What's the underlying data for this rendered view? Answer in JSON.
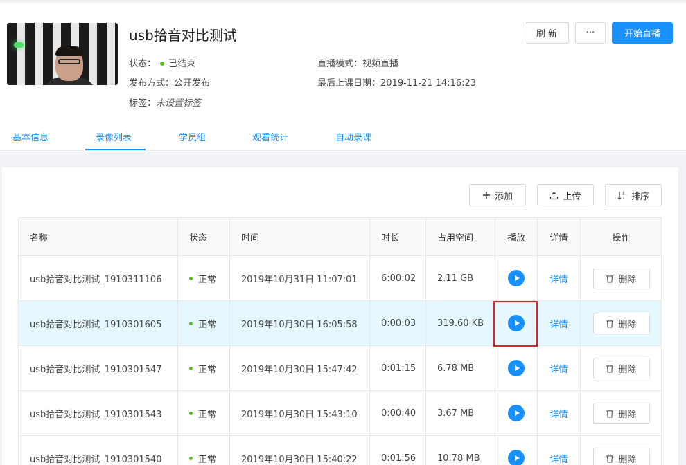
{
  "header": {
    "title": "usb拾音对比测试",
    "status_label": "状态：",
    "status_value": "已结束",
    "publish_label": "发布方式：",
    "publish_value": "公开发布",
    "tag_label": "标签：",
    "tag_value": "未设置标签",
    "mode_label": "直播模式：",
    "mode_value": "视频直播",
    "last_date_label": "最后上课日期：",
    "last_date_value": "2019-11-21 14:16:23",
    "refresh_label": "刷 新",
    "more_label": "···",
    "start_label": "开始直播"
  },
  "tabs": [
    {
      "label": "基本信息"
    },
    {
      "label": "录像列表"
    },
    {
      "label": "学员组"
    },
    {
      "label": "观看统计"
    },
    {
      "label": "自动录课"
    }
  ],
  "toolbar": {
    "add_label": "添加",
    "upload_label": "上传",
    "sort_label": "排序"
  },
  "table": {
    "columns": [
      "名称",
      "状态",
      "时间",
      "时长",
      "占用空间",
      "播放",
      "详情",
      "操作"
    ],
    "detail_label": "详情",
    "delete_label": "删除",
    "rows": [
      {
        "name": "usb拾音对比测试_1910311106",
        "status": "正常",
        "time": "2019年10月31日 11:07:01",
        "duration": "6:00:02",
        "size": "2.11 GB"
      },
      {
        "name": "usb拾音对比测试_1910301605",
        "status": "正常",
        "time": "2019年10月30日 16:05:58",
        "duration": "0:00:03",
        "size": "319.60 KB"
      },
      {
        "name": "usb拾音对比测试_1910301547",
        "status": "正常",
        "time": "2019年10月30日 15:47:42",
        "duration": "0:01:15",
        "size": "6.78 MB"
      },
      {
        "name": "usb拾音对比测试_1910301543",
        "status": "正常",
        "time": "2019年10月30日 15:43:10",
        "duration": "0:00:40",
        "size": "3.67 MB"
      },
      {
        "name": "usb拾音对比测试_1910301540",
        "status": "正常",
        "time": "2019年10月30日 15:40:22",
        "duration": "0:01:56",
        "size": "10.78 MB"
      }
    ]
  },
  "colors": {
    "primary": "#1890ff",
    "status_green": "#52c41a",
    "highlight_row": "#e6f7ff",
    "annotation_red": "#e02424"
  }
}
